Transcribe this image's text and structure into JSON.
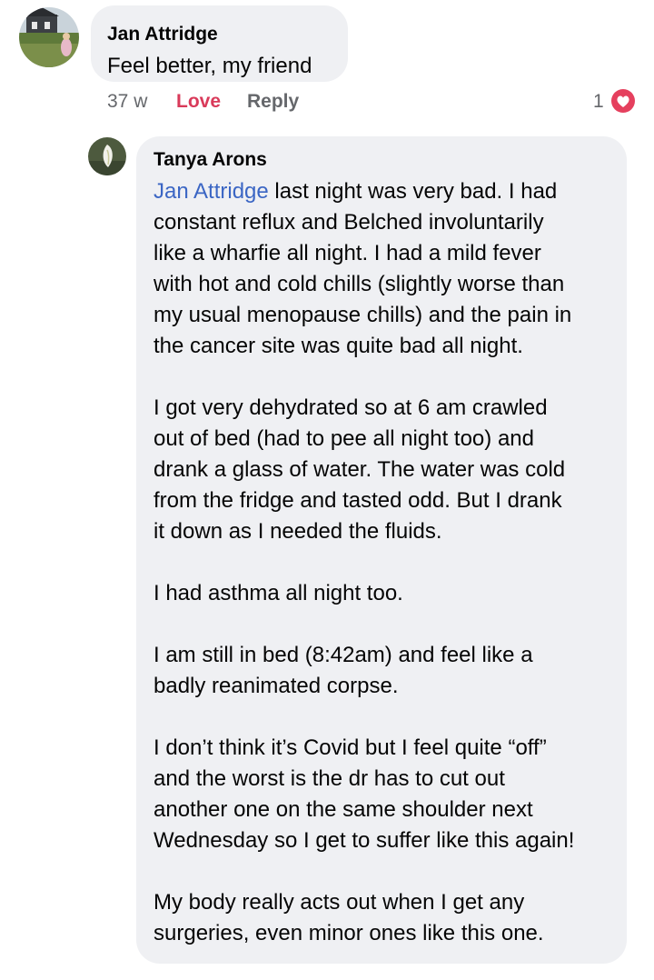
{
  "comment1": {
    "author": "Jan Attridge",
    "text": "Feel better, my friend",
    "time": "37 w",
    "love_label": "Love",
    "reply_label": "Reply",
    "reaction_count": "1",
    "reaction_icon": "love-icon"
  },
  "comment2": {
    "author": "Tanya Arons",
    "mention": "Jan Attridge",
    "lines": [
      " last night was very bad.  I had",
      "constant reflux and Belched involuntarily",
      "like a wharfie all night.  I had a mild fever",
      "with hot and cold chills (slightly worse than",
      "my usual menopause chills)  and the pain in",
      "the cancer site was quite bad all night.",
      "I got very dehydrated so at 6 am crawled",
      "out of bed (had to pee all night too) and",
      "drank a glass of water.  The water was cold",
      "from the fridge and tasted odd.  But I drank",
      "it down as I needed the fluids.",
      "I had asthma all night too.",
      "I am still in bed (8:42am) and feel like a",
      "badly reanimated corpse.",
      "I don’t think it’s Covid but I feel quite “off”",
      "and the worst is the dr has to cut out",
      "another one on the same shoulder next",
      "Wednesday so I get to suffer like this again!",
      "My body really acts out when I get any",
      "surgeries, even minor ones like this one."
    ]
  },
  "colors": {
    "bubble": "#eff0f3",
    "mention": "#3b66c4",
    "love": "#d93a5a",
    "meta": "#65676b"
  }
}
